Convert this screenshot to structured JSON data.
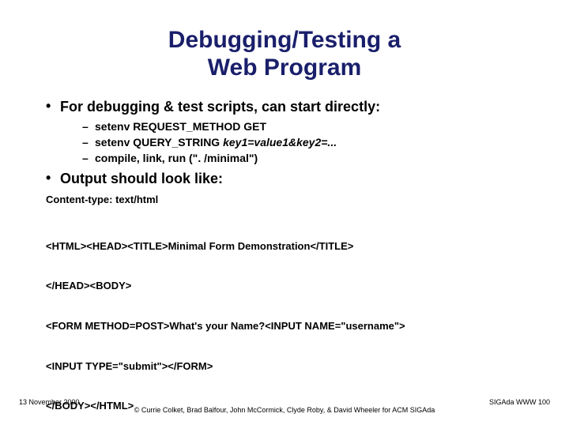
{
  "title_line1": "Debugging/Testing a",
  "title_line2": "Web Program",
  "bullets": {
    "b1": "For debugging & test scripts, can start directly:",
    "b1_sub": {
      "s1": "setenv REQUEST_METHOD GET",
      "s2_prefix": "setenv QUERY_STRING ",
      "s2_italic": "key1=value1&key2=...",
      "s3": "compile, link, run (\". /minimal\")"
    },
    "b2": "Output should look like:"
  },
  "content_type": "Content-type: text/html",
  "code_lines": {
    "l1": "<HTML><HEAD><TITLE>Minimal Form Demonstration</TITLE>",
    "l2": "</HEAD><BODY>",
    "l3": "<FORM METHOD=POST>What's your Name?<INPUT NAME=\"username\">",
    "l4": "<INPUT TYPE=\"submit\"></FORM>",
    "l5": "</BODY></HTML>"
  },
  "footer": {
    "date": "13 November 2000",
    "right": "SIGAda WWW 100",
    "credit": "© Currie Colket, Brad Balfour, John McCormick, Clyde Roby, & David Wheeler for ACM SIGAda"
  }
}
